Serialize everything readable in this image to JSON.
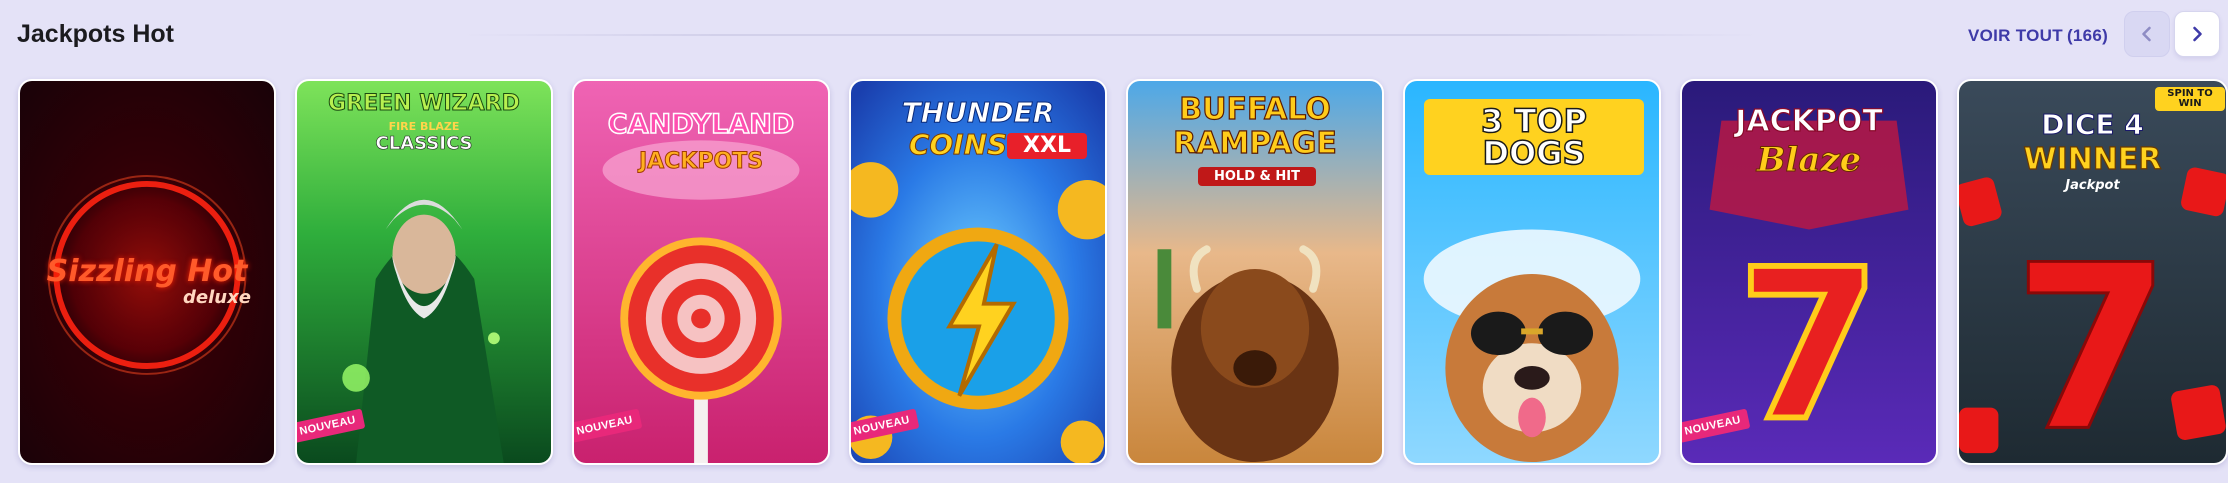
{
  "section": {
    "title": "Jackpots Hot",
    "see_all_label": "VOIR TOUT",
    "see_all_count": "(166)"
  },
  "nav": {
    "prev_icon": "chevron-left-icon",
    "next_icon": "chevron-right-icon"
  },
  "badge_label": "NOUVEAU",
  "games": [
    {
      "line1": "Sizzling Hot",
      "line2": "deluxe",
      "new": false
    },
    {
      "line1": "GREEN WIZARD",
      "line2": "FIRE BLAZE",
      "line3": "CLASSICS",
      "new": true
    },
    {
      "line1": "CANDYLAND",
      "line2": "JACKPOTS",
      "new": true
    },
    {
      "line1": "THUNDER",
      "line2": "COINS",
      "line3": "XXL",
      "new": true
    },
    {
      "line1": "BUFFALO",
      "line2": "RAMPAGE",
      "line3": "HOLD & HIT",
      "new": false
    },
    {
      "line1": "3 TOP DOGS",
      "new": false
    },
    {
      "line1": "JACKPOT",
      "line2": "Blaze",
      "new": true
    },
    {
      "line1": "DICE 4",
      "line2": "WINNER",
      "line3": "Jackpot",
      "extra": "SPIN TO WIN",
      "new": false
    }
  ],
  "colors": {
    "background": "#e4e2f7",
    "accent": "#3e3aa8",
    "badge": "#e8287a"
  }
}
